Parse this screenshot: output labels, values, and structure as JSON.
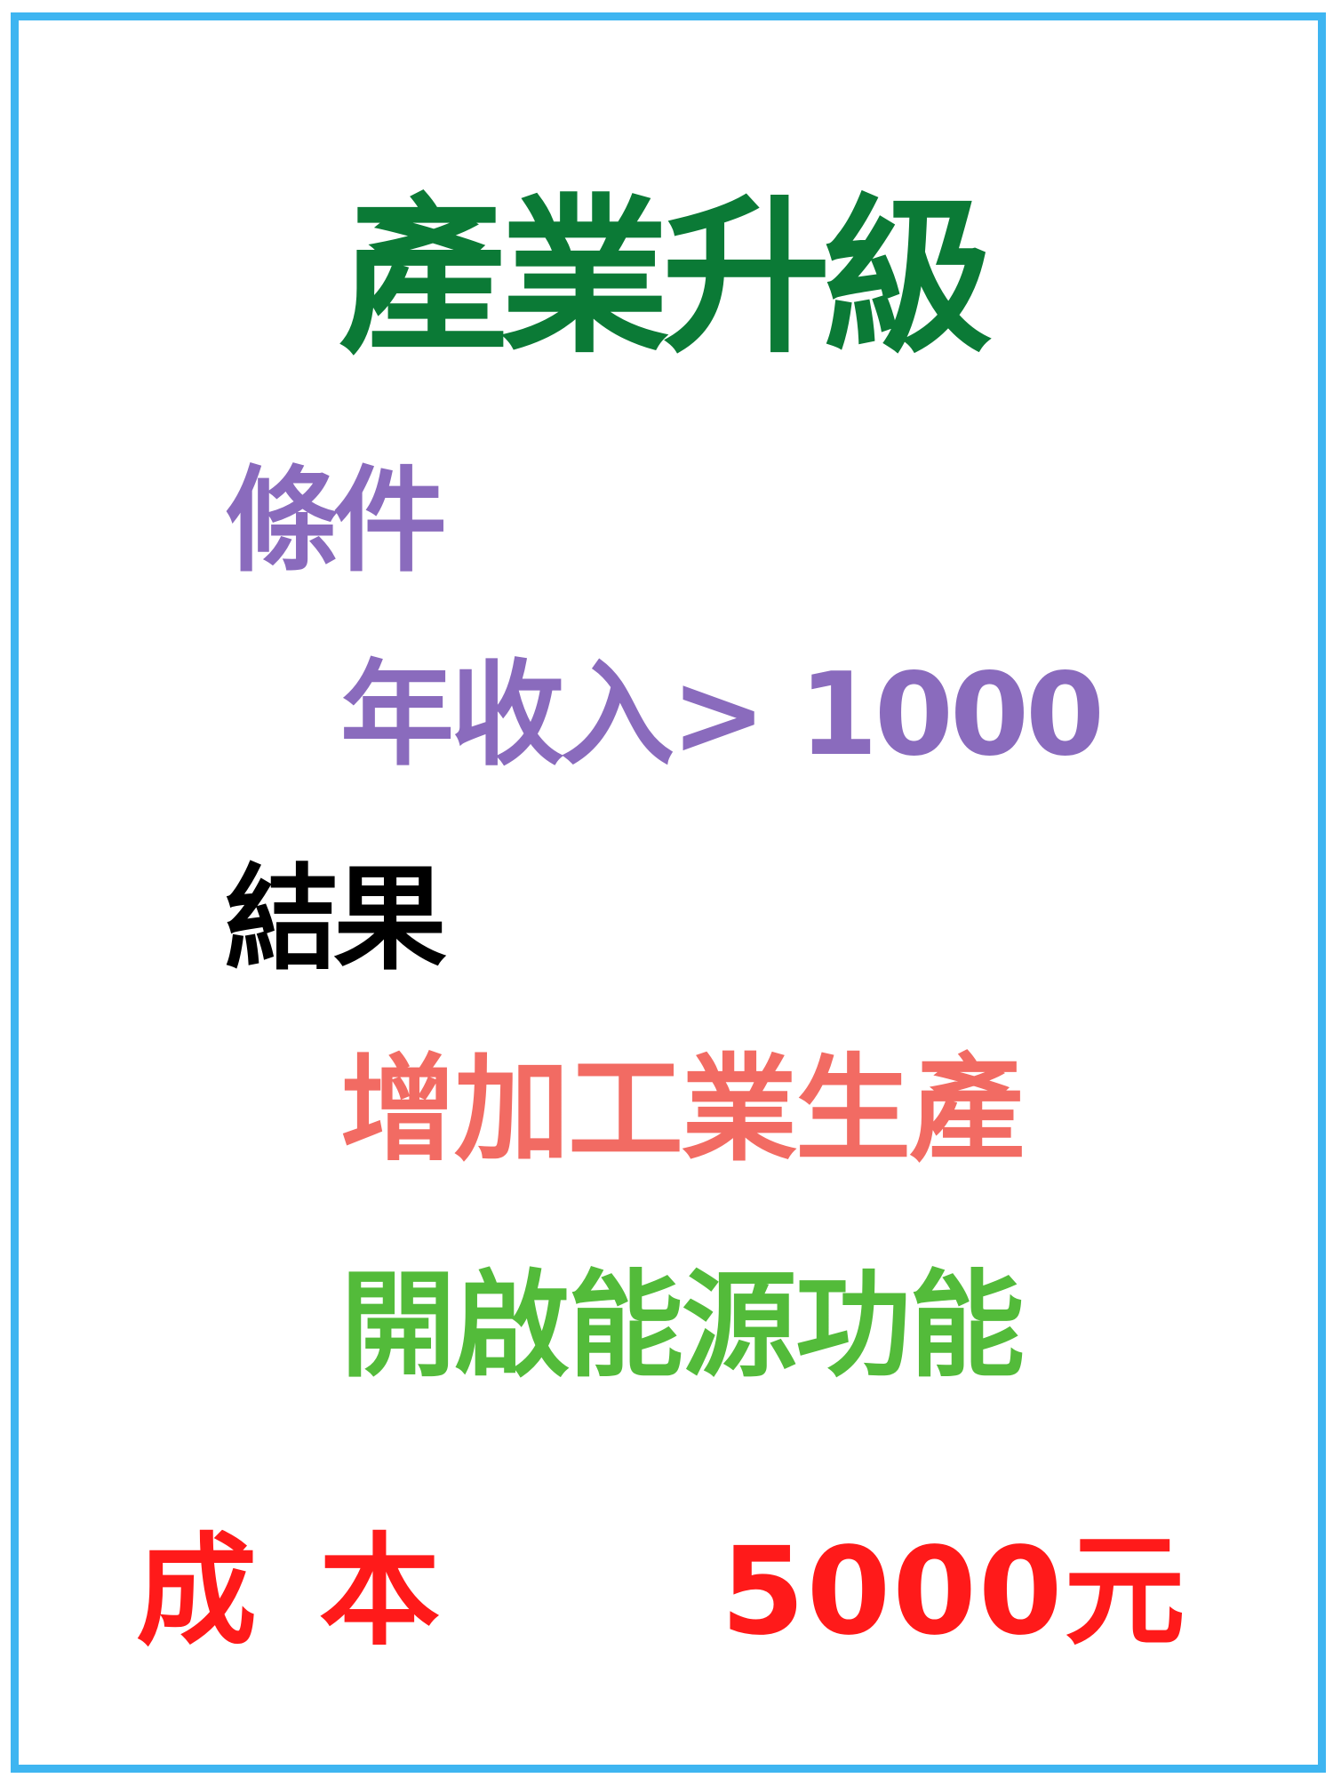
{
  "card": {
    "title": "產業升級",
    "condition": {
      "heading": "條件",
      "text": "年收入> 1000"
    },
    "result": {
      "heading": "結果",
      "items": [
        "增加工業生產",
        "開啟能源功能"
      ]
    },
    "cost": {
      "label": "成本",
      "value": "5000元"
    }
  },
  "colors": {
    "border": "#3eb5f1",
    "title": "#0b7a36",
    "condition": "#8a6bbd",
    "result_heading": "#000000",
    "result_item_1": "#f26b63",
    "result_item_2": "#53bb3a",
    "cost": "#ff1a1a"
  }
}
